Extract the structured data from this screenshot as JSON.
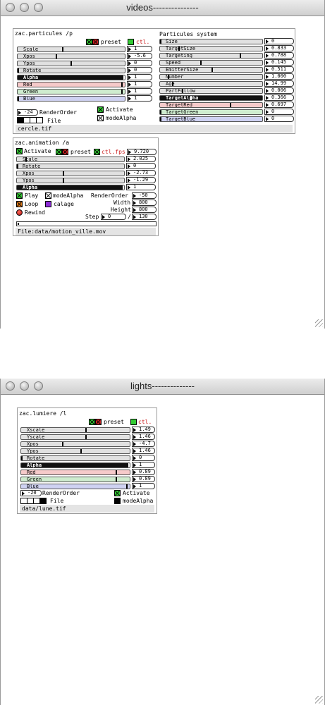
{
  "windows": {
    "videos": {
      "title": "videos---------------"
    },
    "lights": {
      "title": "lights--------------"
    }
  },
  "particules": {
    "header": "zac.particules /p",
    "preset_label": "preset",
    "ctl_label": "ctl.",
    "sliders": [
      {
        "label": "Scale",
        "value": "1",
        "level": 0.42
      },
      {
        "label": "Xpos",
        "value": "-5.6",
        "level": 0.36
      },
      {
        "label": "Ypos",
        "value": "0",
        "level": 0.5
      },
      {
        "label": "Rotate",
        "value": "0",
        "level": 0.0
      },
      {
        "label": "Alpha",
        "value": "1",
        "level": 1.0
      },
      {
        "label": "Red",
        "value": "1",
        "level": 0.98
      },
      {
        "label": "Green",
        "value": "1",
        "level": 0.98
      },
      {
        "label": "Blue",
        "value": "1",
        "level": 0.0
      }
    ],
    "render_order": "-24",
    "render_order_label": "RenderOrder",
    "file_label": "File",
    "activate_label": "Activate",
    "modealpha_label": "modeAlpha",
    "status": "cercle.tif"
  },
  "system": {
    "header": "Particules system",
    "sliders": [
      {
        "label": "Size",
        "value": "0",
        "level": 0.0
      },
      {
        "label": "TargetSize",
        "value": "0.833",
        "level": 0.18
      },
      {
        "label": "Targeting",
        "value": "0.788",
        "level": 0.79
      },
      {
        "label": "Speed",
        "value": "0.145",
        "level": 0.4
      },
      {
        "label": "EmitterSize",
        "value": "0.511",
        "level": 0.51
      },
      {
        "label": "Number",
        "value": "1.000",
        "level": 0.08
      },
      {
        "label": "Age",
        "value": "14.99",
        "level": 0.12
      },
      {
        "label": "PartFollow",
        "value": "0.006",
        "level": 0.22
      },
      {
        "label": "TargetAlpha",
        "value": "0.366",
        "level": 0.3
      },
      {
        "label": "TargetRed",
        "value": "0.697",
        "level": 0.69
      },
      {
        "label": "TargetGreen",
        "value": "0",
        "level": 0.0
      },
      {
        "label": "TargetBlue",
        "value": "0",
        "level": 0.0
      }
    ]
  },
  "animation": {
    "header": "zac.animation /a",
    "activate_label": "Activate",
    "preset_label": "preset",
    "ctl_label": "ctl.fps",
    "fps": "9.720",
    "sliders": [
      {
        "label": "Scale",
        "value": "2.025",
        "level": 0.08
      },
      {
        "label": "Rotate",
        "value": "0",
        "level": 0.0
      },
      {
        "label": "Xpos",
        "value": "-2.73",
        "level": 0.43
      },
      {
        "label": "Ypos",
        "value": "-1.29",
        "level": 0.43
      },
      {
        "label": "Alpha",
        "value": "1",
        "level": 1.0
      }
    ],
    "play_label": "Play",
    "modealpha_label": "modeAlpha",
    "render_order_label": "RenderOrder",
    "render_order": "-50",
    "loop_label": "Loop",
    "calage_label": "calage",
    "width_label": "Width",
    "width": "800",
    "height_label": "Height",
    "height": "800",
    "rewind_label": "Rewind",
    "step_label": "Step",
    "step": "0",
    "step_sep": "/",
    "step_total": "130",
    "status": "File:data/motion_ville.mov"
  },
  "lumiere": {
    "header": "zac.lumiere /l",
    "preset_label": "preset",
    "ctl_label": "ctl.",
    "sliders": [
      {
        "label": "Xscale",
        "value": "1.49",
        "level": 0.6
      },
      {
        "label": "Yscale",
        "value": "1.46",
        "level": 0.6
      },
      {
        "label": "Xpos",
        "value": "-4.7",
        "level": 0.38
      },
      {
        "label": "Ypos",
        "value": "1.46",
        "level": 0.55
      },
      {
        "label": "Rotate",
        "value": "0",
        "level": 0.0
      },
      {
        "label": "Alpha",
        "value": "1",
        "level": 1.0
      },
      {
        "label": "Red",
        "value": "0.89",
        "level": 0.88
      },
      {
        "label": "Green",
        "value": "0.89",
        "level": 0.88
      },
      {
        "label": "Blue",
        "value": "1",
        "level": 0.98
      }
    ],
    "render_order": "-20",
    "render_order_label": "RenderOrder",
    "activate_label": "Activate",
    "file_label": "File",
    "modealpha_label": "modeAlpha",
    "status": "data/lune.tif"
  },
  "colors": {
    "alpha_bg": "#111111",
    "red_bg": "#f6caca",
    "green_bg": "#cfeccf",
    "blue_bg": "#cfd2f2",
    "default_bg": "#e1e1e1",
    "toggle_green": "#33cc33",
    "toggle_red": "#cc2222"
  }
}
